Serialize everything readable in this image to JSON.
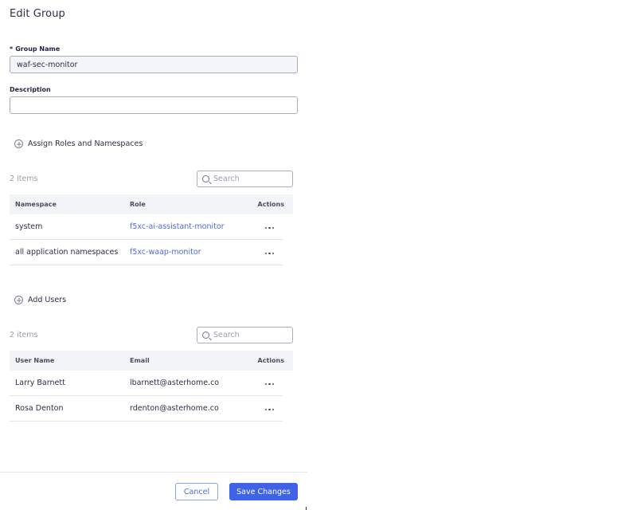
{
  "dialog": {
    "title": "Edit Group"
  },
  "group_name": {
    "required_mark": "*",
    "label": "Group Name",
    "value": "waf-sec-monitor"
  },
  "description": {
    "label": "Description",
    "value": ""
  },
  "roles_section": {
    "add_label": "Assign Roles and Namespaces",
    "count_text": "2 items",
    "search_placeholder": "Search",
    "columns": [
      "Namespace",
      "Role",
      "Actions"
    ],
    "rows": [
      {
        "namespace": "system",
        "role": "f5xc-ai-assistant-monitor"
      },
      {
        "namespace": "all application namespaces",
        "role": "f5xc-waap-monitor"
      }
    ]
  },
  "users_section": {
    "add_label": "Add Users",
    "count_text": "2 items",
    "search_placeholder": "Search",
    "columns": [
      "User Name",
      "Email",
      "Actions"
    ],
    "rows": [
      {
        "name": "Larry Barnett",
        "email": "lbarnett@asterhome.co"
      },
      {
        "name": "Rosa Denton",
        "email": "rdenton@asterhome.co"
      }
    ]
  },
  "footer": {
    "cancel_label": "Cancel",
    "save_label": "Save Changes"
  },
  "colors": {
    "primary": "#3e63e6",
    "link": "#4e6bd8",
    "text": "#2b2f45"
  },
  "icons": [
    "plus-circle-icon",
    "search-icon",
    "more-actions-icon"
  ]
}
